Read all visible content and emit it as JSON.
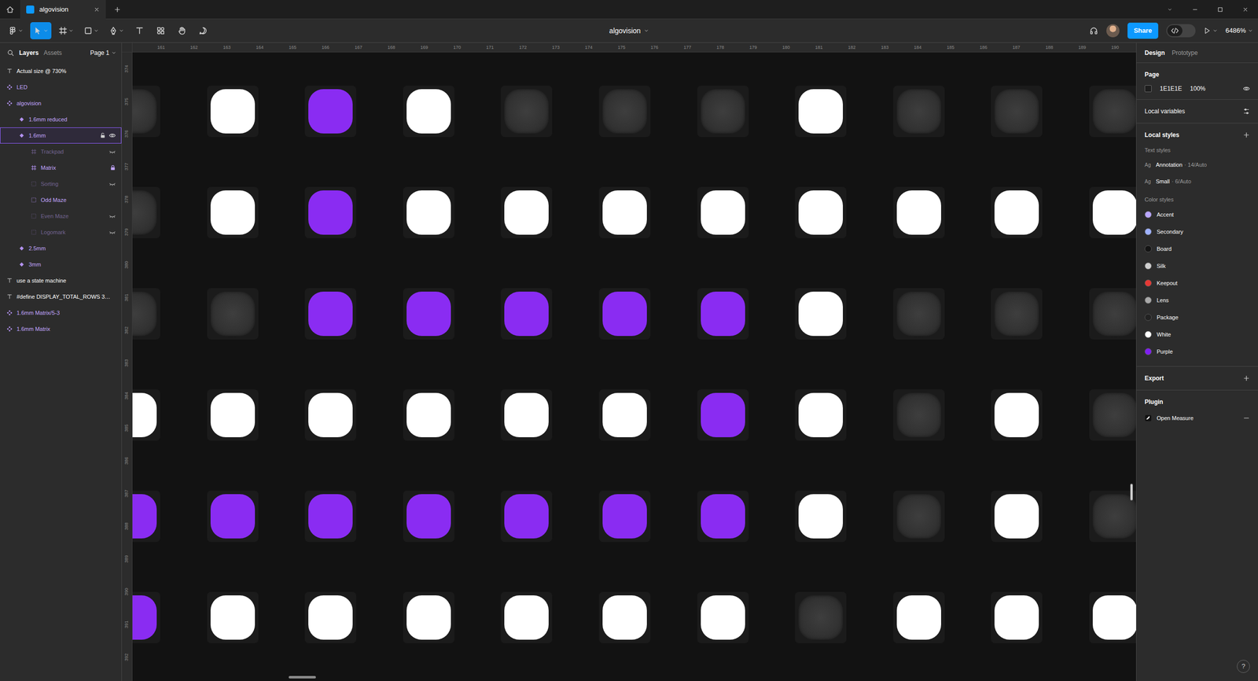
{
  "window": {
    "tab_title": "algovision"
  },
  "toolbar": {
    "tools": [
      {
        "kind": "menu",
        "selected": false
      },
      {
        "kind": "move",
        "selected": true
      },
      {
        "kind": "frame",
        "selected": false
      },
      {
        "kind": "shape",
        "selected": false
      },
      {
        "kind": "pen",
        "selected": false
      },
      {
        "kind": "text",
        "selected": false
      },
      {
        "kind": "resources",
        "selected": false
      },
      {
        "kind": "hand",
        "selected": false
      },
      {
        "kind": "comment",
        "selected": false
      }
    ],
    "file_name": "algovision",
    "share": "Share",
    "dev_mode": {
      "on": false
    },
    "zoom": "6486%"
  },
  "left_panel": {
    "tabs": [
      {
        "label": "Layers",
        "selected": true
      },
      {
        "label": "Assets",
        "selected": false
      }
    ],
    "page": "Page 1",
    "layers": [
      {
        "name": "Actual size @ 730%",
        "kind": "text",
        "selected": false,
        "hidden": false,
        "locked": false,
        "children": []
      },
      {
        "name": "LED",
        "kind": "component",
        "selected": false,
        "hidden": false,
        "locked": false,
        "children": []
      },
      {
        "name": "algovision",
        "kind": "component",
        "selected": false,
        "hidden": false,
        "locked": false,
        "children": [
          {
            "name": "1.6mm reduced",
            "kind": "variant",
            "selected": false,
            "hidden": false,
            "locked": false,
            "children": []
          },
          {
            "name": "1.6mm",
            "kind": "variant",
            "selected": true,
            "hidden": false,
            "locked": false,
            "children": [
              {
                "name": "Trackpad",
                "kind": "grid",
                "selected": false,
                "hidden": true,
                "locked": false,
                "children": []
              },
              {
                "name": "Matrix",
                "kind": "grid",
                "selected": false,
                "hidden": false,
                "locked": true,
                "children": []
              },
              {
                "name": "Sorting",
                "kind": "dashed",
                "selected": false,
                "hidden": true,
                "locked": false,
                "children": []
              },
              {
                "name": "Odd Maze",
                "kind": "dashed",
                "selected": false,
                "hidden": false,
                "locked": false,
                "children": []
              },
              {
                "name": "Even Maze",
                "kind": "dashed",
                "selected": false,
                "hidden": true,
                "locked": false,
                "children": []
              },
              {
                "name": "Logomark",
                "kind": "dashed",
                "selected": false,
                "hidden": true,
                "locked": false,
                "children": []
              }
            ]
          },
          {
            "name": "2.5mm",
            "kind": "variant",
            "selected": false,
            "hidden": false,
            "locked": false,
            "children": []
          },
          {
            "name": "3mm",
            "kind": "variant",
            "selected": false,
            "hidden": false,
            "locked": false,
            "children": []
          }
        ]
      },
      {
        "name": "use a state machine",
        "kind": "text",
        "selected": false,
        "hidden": false,
        "locked": false,
        "children": []
      },
      {
        "name": "#define DISPLAY_TOTAL_ROWS 3…",
        "kind": "text",
        "selected": false,
        "hidden": false,
        "locked": false,
        "children": []
      },
      {
        "name": "1.6mm Matrix/5-3",
        "kind": "component",
        "selected": false,
        "hidden": false,
        "locked": false,
        "children": []
      },
      {
        "name": "1.6mm Matrix",
        "kind": "component",
        "selected": false,
        "hidden": false,
        "locked": false,
        "children": []
      }
    ]
  },
  "rulers": {
    "top": [
      "161",
      "162",
      "163",
      "164",
      "165",
      "166",
      "167",
      "168",
      "169",
      "170",
      "171",
      "172",
      "173",
      "174",
      "175",
      "176",
      "177",
      "178",
      "179",
      "180",
      "181",
      "182",
      "183",
      "184",
      "185",
      "186",
      "187",
      "188",
      "189",
      "190"
    ],
    "left": [
      "374",
      "375",
      "376",
      "377",
      "378",
      "379",
      "380",
      "381",
      "382",
      "383",
      "384",
      "385",
      "386",
      "387",
      "388",
      "389",
      "390",
      "391",
      "392"
    ]
  },
  "canvas": {
    "leds": [
      [
        "off",
        "white",
        "purple",
        "white",
        "off",
        "off",
        "off",
        "white",
        "off",
        "off",
        "off"
      ],
      [
        "off",
        "white",
        "purple",
        "white",
        "white",
        "white",
        "white",
        "white",
        "white",
        "white",
        "white"
      ],
      [
        "off",
        "off",
        "purple",
        "purple",
        "purple",
        "purple",
        "purple",
        "white",
        "off",
        "off",
        "off"
      ],
      [
        "white",
        "white",
        "white",
        "white",
        "white",
        "white",
        "purple",
        "white",
        "off",
        "white",
        "off"
      ],
      [
        "purple",
        "purple",
        "purple",
        "purple",
        "purple",
        "purple",
        "purple",
        "white",
        "off",
        "white",
        "off"
      ],
      [
        "purple",
        "white",
        "white",
        "white",
        "white",
        "white",
        "white",
        "off",
        "white",
        "white",
        "white"
      ]
    ]
  },
  "right_panel": {
    "tabs": [
      {
        "label": "Design",
        "selected": true
      },
      {
        "label": "Prototype",
        "selected": false
      }
    ],
    "page": {
      "title": "Page",
      "fill": "1E1E1E",
      "opacity": "100%"
    },
    "local_variables": "Local variables",
    "local_styles": "Local styles",
    "text_styles_title": "Text styles",
    "text_styles": [
      {
        "sample": "Ag",
        "name": "Annotation",
        "detail": "· 14/Auto"
      },
      {
        "sample": "Ag",
        "name": "Small",
        "detail": "· 6/Auto"
      }
    ],
    "color_styles_title": "Color styles",
    "color_styles": [
      {
        "name": "Accent",
        "color": "#b9a6ff"
      },
      {
        "name": "Secondary",
        "color": "#9fb2ff"
      },
      {
        "name": "Board",
        "color": "#141414"
      },
      {
        "name": "Silk",
        "color": "#cfcfcf"
      },
      {
        "name": "Keepout",
        "color": "#e53935"
      },
      {
        "name": "Lens",
        "color": "#a8a8a8"
      },
      {
        "name": "Package",
        "color": "#222222"
      },
      {
        "name": "White",
        "color": "#ffffff"
      },
      {
        "name": "Purple",
        "color": "#7f1ff0"
      }
    ],
    "export": "Export",
    "plugin": "Plugin",
    "plugin_item": "Open Measure"
  },
  "help": "?"
}
